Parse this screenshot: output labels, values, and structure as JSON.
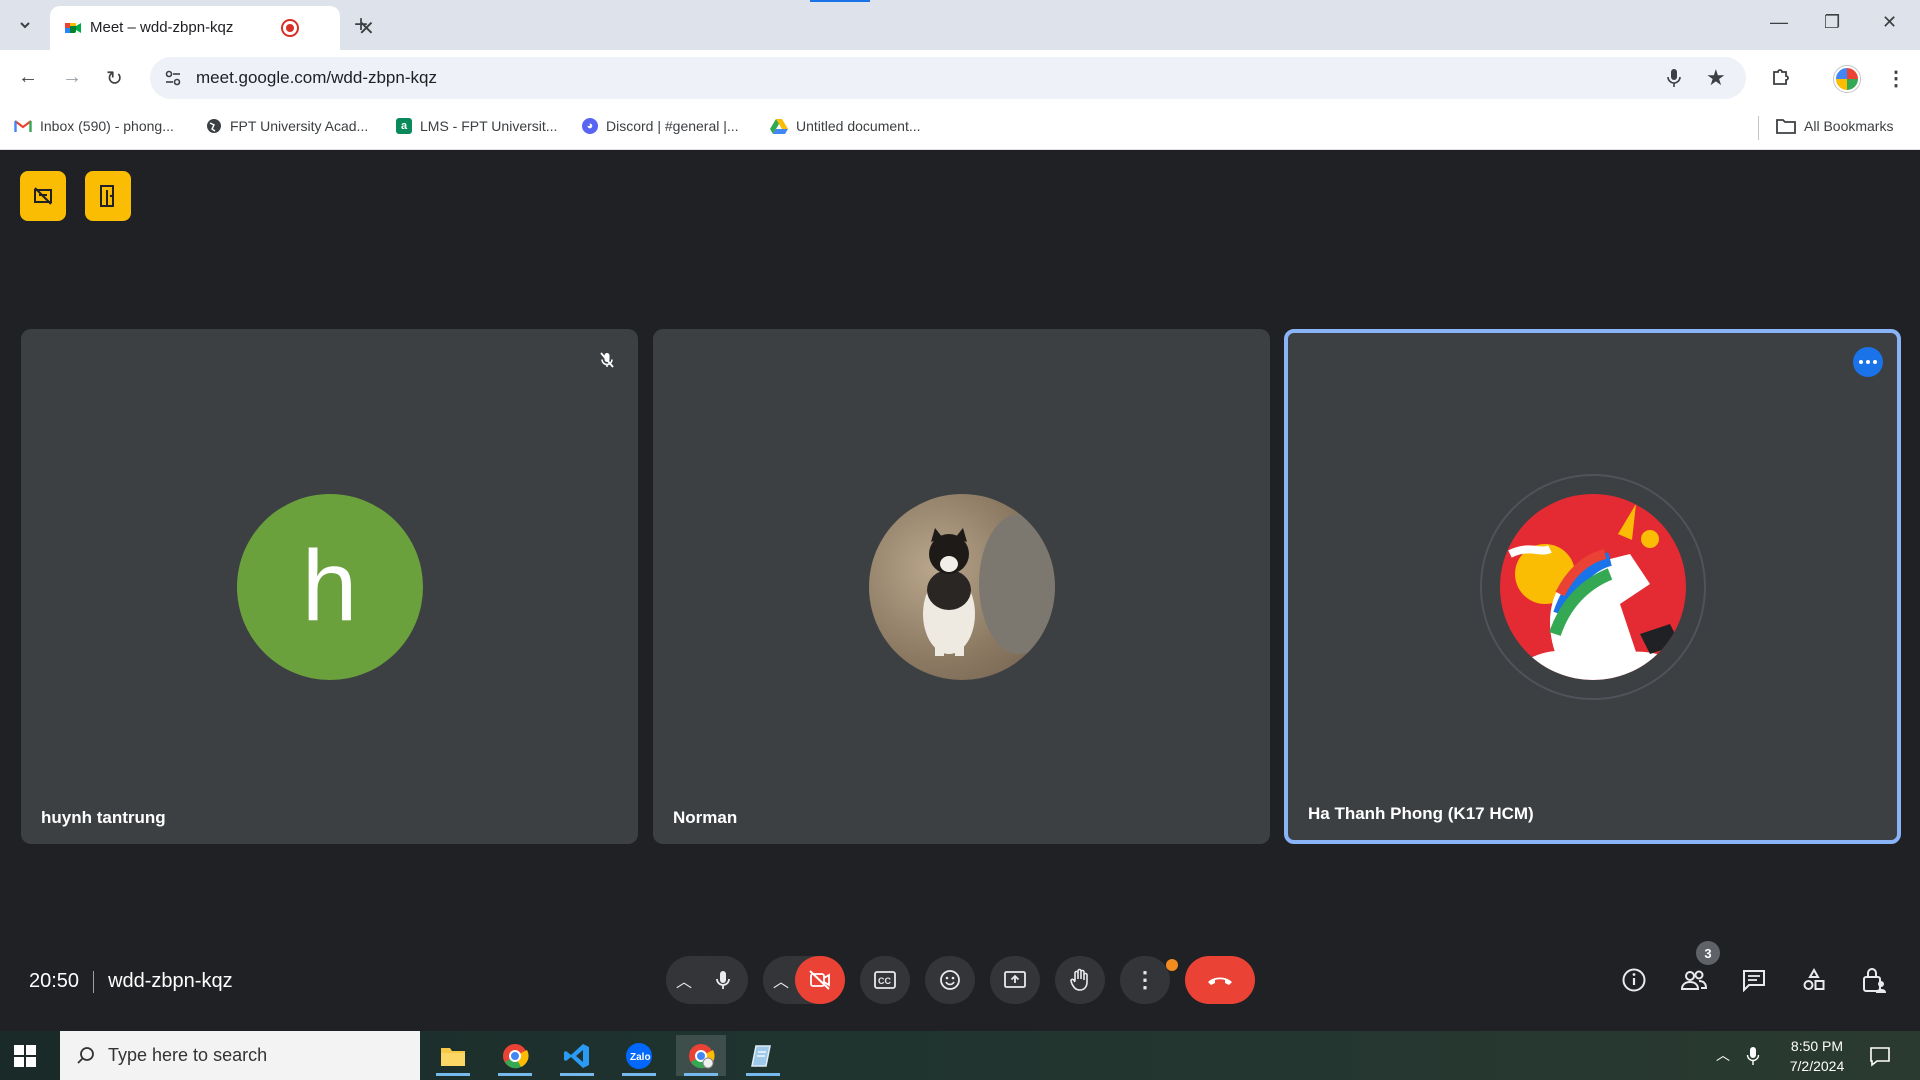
{
  "browser": {
    "tab_title": "Meet – wdd-zbpn-kqz",
    "url": "meet.google.com/wdd-zbpn-kqz",
    "bookmarks": [
      {
        "label": "Inbox (590) - phong...",
        "icon": "gmail-icon"
      },
      {
        "label": "FPT University Acad...",
        "icon": "globe-icon"
      },
      {
        "label": "LMS - FPT Universit...",
        "icon": "lms-icon"
      },
      {
        "label": "Discord | #general |...",
        "icon": "discord-icon"
      },
      {
        "label": "Untitled document...",
        "icon": "google-drive-icon"
      }
    ],
    "all_bookmarks": "All Bookmarks"
  },
  "meet": {
    "meeting_code": "wdd-zbpn-kqz",
    "time": "20:50",
    "participants_count": "3",
    "participants": [
      {
        "name": "huynh tantrung",
        "avatar_letter": "h",
        "muted": true
      },
      {
        "name": "Norman",
        "avatar": "cat-photo"
      },
      {
        "name": "Ha Thanh Phong (K17 HCM)",
        "avatar": "unicorn-image",
        "active": true
      }
    ]
  },
  "taskbar": {
    "search_placeholder": "Type here to search",
    "time": "8:50 PM",
    "date": "7/2/2024"
  },
  "colors": {
    "meet_bg": "#202124",
    "tile_bg": "#3c4043",
    "accent": "#8ab4f8",
    "end_call": "#ea4335",
    "host_controls": "#fbbc04"
  }
}
